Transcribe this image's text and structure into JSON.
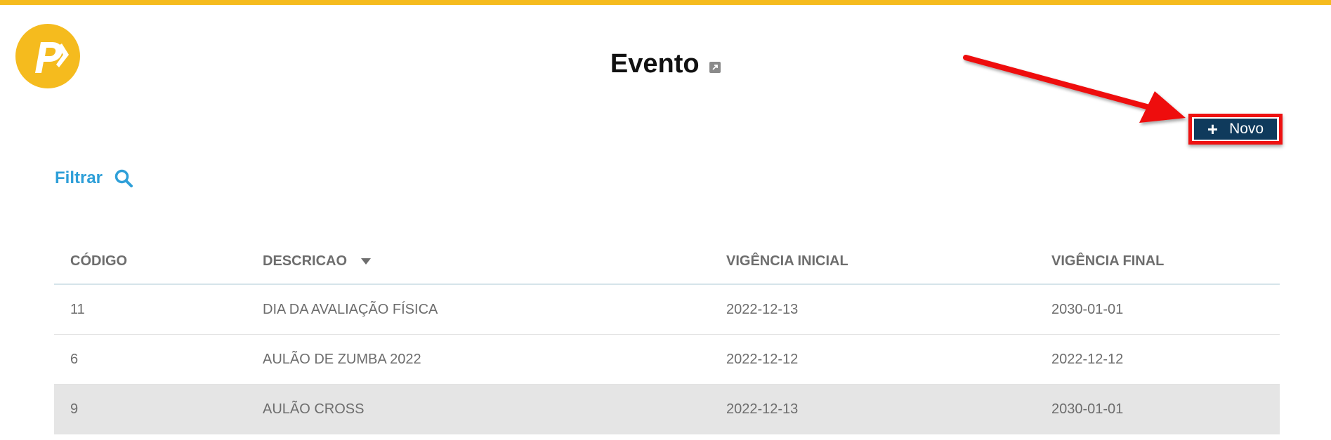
{
  "header": {
    "logo_text": "P",
    "title": "Evento",
    "title_link_icon": "external-link-icon"
  },
  "toolbar": {
    "new_label": "Novo",
    "new_icon": "plus-icon"
  },
  "filter": {
    "label": "Filtrar",
    "icon": "search-icon"
  },
  "table": {
    "columns": [
      "CÓDIGO",
      "DESCRICAO",
      "VIGÊNCIA INICIAL",
      "VIGÊNCIA FINAL"
    ],
    "sorted_column": "DESCRICAO",
    "rows": [
      [
        "11",
        "DIA DA AVALIAÇÃO FÍSICA",
        "2022-12-13",
        "2030-01-01"
      ],
      [
        "6",
        "AULÃO DE ZUMBA 2022",
        "2022-12-12",
        "2022-12-12"
      ],
      [
        "9",
        "AULÃO CROSS",
        "2022-12-13",
        "2030-01-01"
      ]
    ],
    "selected_row": 2
  },
  "colors": {
    "brand_yellow": "#f5bb1e",
    "primary_button": "#0f3a5c",
    "link_blue": "#2e9fd8",
    "annotation_red": "#ee1111"
  }
}
